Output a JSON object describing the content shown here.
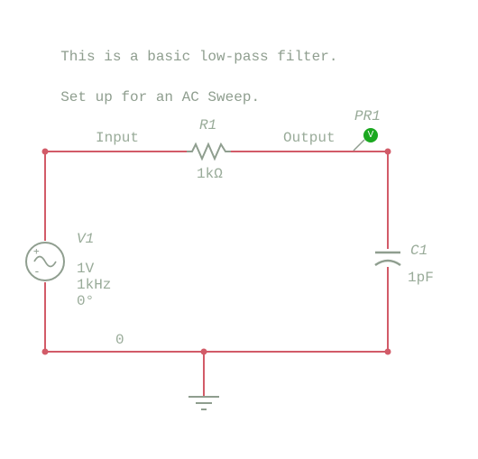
{
  "caption": {
    "line1": "This is a basic low-pass filter.",
    "line2": "Set up for an AC Sweep."
  },
  "nets": {
    "input": "Input",
    "output": "Output",
    "ground": "0"
  },
  "components": {
    "source": {
      "name": "V1",
      "amplitude": "1V",
      "frequency": "1kHz",
      "phase": "0°"
    },
    "resistor": {
      "name": "R1",
      "value": "1kΩ"
    },
    "capacitor": {
      "name": "C1",
      "value": "1pF"
    },
    "probe": {
      "name": "PR1",
      "letter": "V"
    }
  }
}
